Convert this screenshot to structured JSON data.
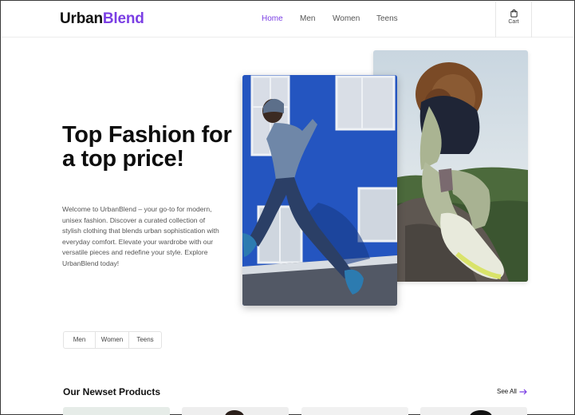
{
  "brand": {
    "name_part1": "Urban",
    "name_part2": "Blend",
    "accent_color": "#7b3fe4"
  },
  "nav": {
    "items": [
      {
        "label": "Home",
        "active": true
      },
      {
        "label": "Men",
        "active": false
      },
      {
        "label": "Women",
        "active": false
      },
      {
        "label": "Teens",
        "active": false
      }
    ],
    "cart_label": "Cart",
    "cart_icon": "shopping-bag-icon"
  },
  "hero": {
    "title": "Top Fashion for a top price!",
    "description": "Welcome to UrbanBlend – your go-to for modern, unisex fashion. Discover a curated collection of stylish clothing that blends urban sophistication with everyday comfort. Elevate your wardrobe with our versatile pieces and redefine your style. Explore UrbanBlend today!"
  },
  "filters": [
    "Men",
    "Women",
    "Teens"
  ],
  "products_section": {
    "title": "Our Newset Products",
    "see_all_label": "See All",
    "see_all_icon": "arrow-right-icon"
  }
}
